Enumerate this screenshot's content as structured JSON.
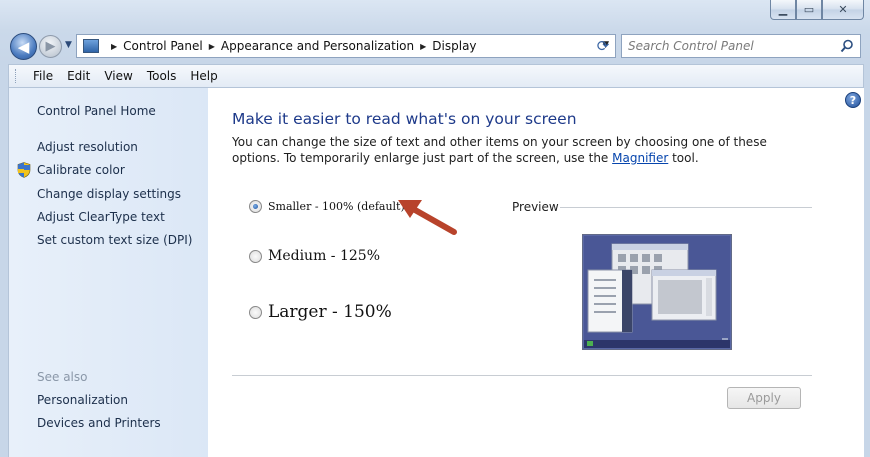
{
  "window": {
    "caption_buttons": [
      "minimize",
      "maximize",
      "close"
    ]
  },
  "address_bar": {
    "breadcrumbs": [
      "Control Panel",
      "Appearance and Personalization",
      "Display"
    ]
  },
  "search": {
    "placeholder": "Search Control Panel"
  },
  "menu": {
    "items": [
      "File",
      "Edit",
      "View",
      "Tools",
      "Help"
    ]
  },
  "sidebar": {
    "home": "Control Panel Home",
    "links": [
      "Adjust resolution",
      "Calibrate color",
      "Change display settings",
      "Adjust ClearType text",
      "Set custom text size (DPI)"
    ],
    "see_also_title": "See also",
    "see_also": [
      "Personalization",
      "Devices and Printers"
    ]
  },
  "main": {
    "title": "Make it easier to read what's on your screen",
    "description_part1": "You can change the size of text and other items on your screen by choosing one of these options. To temporarily enlarge just part of the screen, use the ",
    "description_link": "Magnifier",
    "description_part2": " tool.",
    "options": [
      {
        "label": "Smaller - 100% (default)",
        "checked": true
      },
      {
        "label": "Medium - 125%",
        "checked": false
      },
      {
        "label": "Larger - 150%",
        "checked": false
      }
    ],
    "preview_label": "Preview",
    "apply_label": "Apply"
  },
  "colors": {
    "title_blue": "#1e3a8a",
    "link_blue": "#0645ad",
    "annotation_arrow": "#b8432b"
  }
}
